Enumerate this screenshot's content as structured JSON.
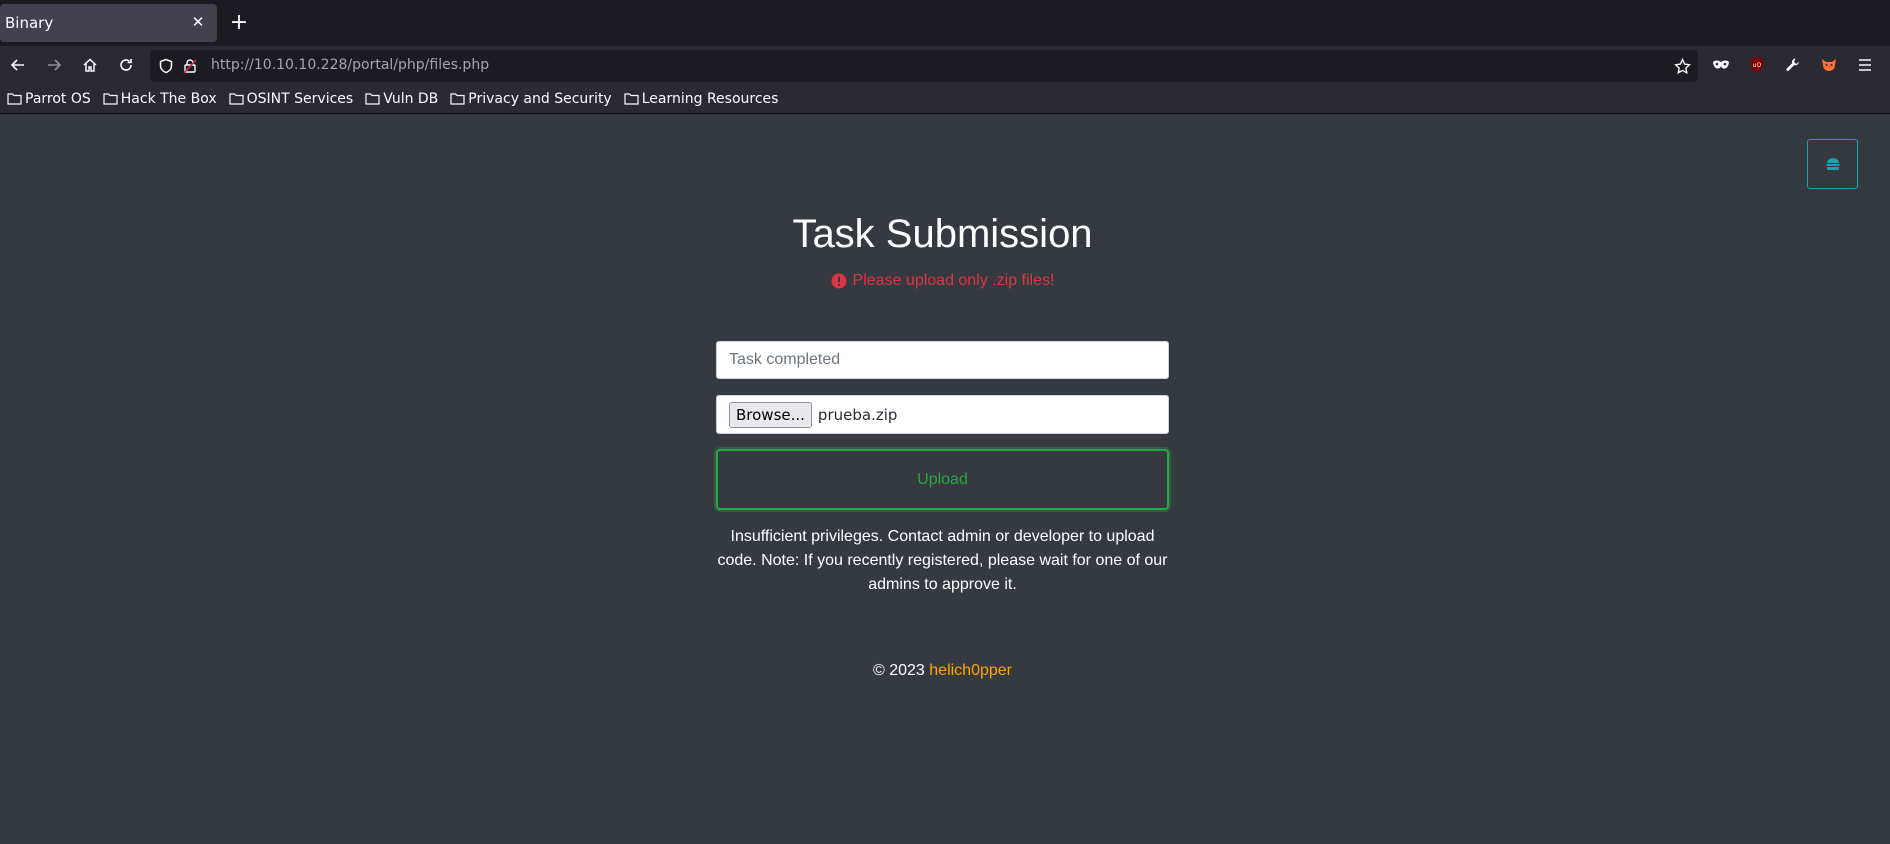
{
  "browser": {
    "tab_title": "Binary",
    "url_host": "http://10.10.10.228",
    "url_path": "/portal/php/files.php",
    "bookmarks": [
      "Parrot OS",
      "Hack The Box",
      "OSINT Services",
      "Vuln DB",
      "Privacy and Security",
      "Learning Resources"
    ]
  },
  "page": {
    "title": "Task Submission",
    "alert": "Please upload only .zip files!",
    "task_input_placeholder": "Task completed",
    "browse_label": "Browse...",
    "file_name": "prueba.zip",
    "upload_label": "Upload",
    "notice": "Insufficient privileges. Contact admin or developer to upload code. Note: If you recently registered, please wait for one of our admins to approve it.",
    "footer_prefix": "© 2023",
    "footer_author": "helich0pper"
  },
  "colors": {
    "background": "#343a40",
    "alert": "#dc3545",
    "success": "#28a745",
    "info": "#17a2b8",
    "author": "#ffa500"
  }
}
